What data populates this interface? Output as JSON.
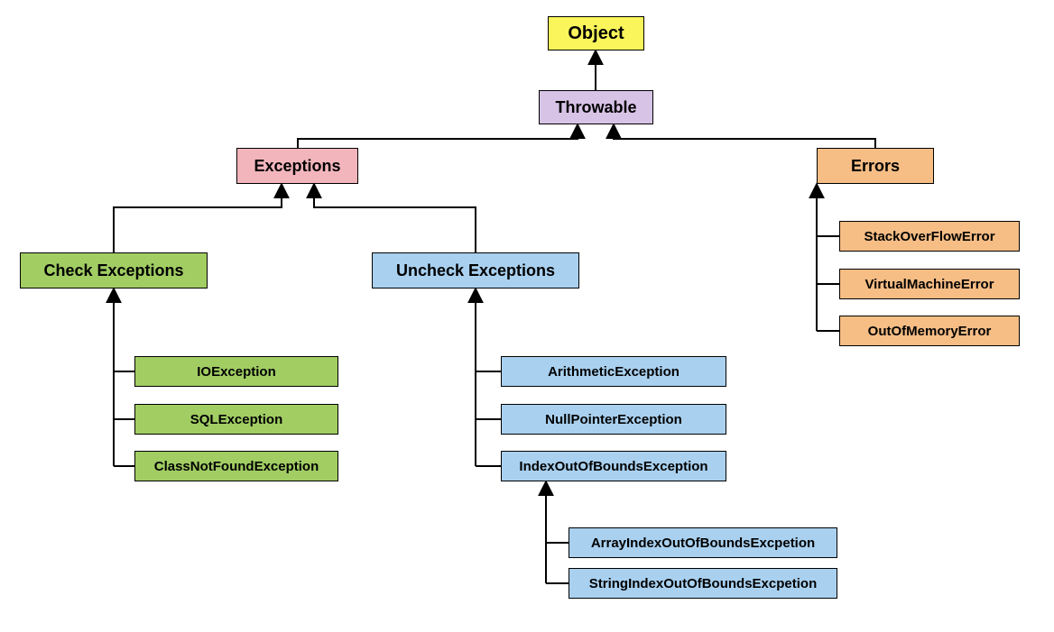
{
  "chart_data": {
    "type": "tree",
    "root": "Object",
    "edges": [
      [
        "Throwable",
        "Object"
      ],
      [
        "Exceptions",
        "Throwable"
      ],
      [
        "Errors",
        "Throwable"
      ],
      [
        "Check Exceptions",
        "Exceptions"
      ],
      [
        "Uncheck Exceptions",
        "Exceptions"
      ],
      [
        "IOException",
        "Check Exceptions"
      ],
      [
        "SQLException",
        "Check Exceptions"
      ],
      [
        "ClassNotFoundException",
        "Check Exceptions"
      ],
      [
        "ArithmeticException",
        "Uncheck Exceptions"
      ],
      [
        "NullPointerException",
        "Uncheck Exceptions"
      ],
      [
        "IndexOutOfBoundsException",
        "Uncheck Exceptions"
      ],
      [
        "ArrayIndexOutOfBoundsExcpetion",
        "IndexOutOfBoundsException"
      ],
      [
        "StringIndexOutOfBoundsExcpetion",
        "IndexOutOfBoundsException"
      ],
      [
        "StackOverFlowError",
        "Errors"
      ],
      [
        "VirtualMachineError",
        "Errors"
      ],
      [
        "OutOfMemoryError",
        "Errors"
      ]
    ]
  },
  "colors": {
    "yellow": "#faf55a",
    "purple": "#d7c3e6",
    "pink": "#f3b5bc",
    "green": "#a1cd63",
    "blue": "#a9d0ef",
    "orange": "#f6bd85"
  },
  "nodes": {
    "object": {
      "label": "Object"
    },
    "throwable": {
      "label": "Throwable"
    },
    "exceptions": {
      "label": "Exceptions"
    },
    "errors": {
      "label": "Errors"
    },
    "checkEx": {
      "label": "Check Exceptions"
    },
    "uncheckEx": {
      "label": "Uncheck Exceptions"
    },
    "ioException": {
      "label": "IOException"
    },
    "sqlException": {
      "label": "SQLException"
    },
    "cnfException": {
      "label": "ClassNotFoundException"
    },
    "arithmetic": {
      "label": "ArithmeticException"
    },
    "nullPtr": {
      "label": "NullPointerException"
    },
    "indexOOB": {
      "label": "IndexOutOfBoundsException"
    },
    "arrayOOB": {
      "label": "ArrayIndexOutOfBoundsExcpetion"
    },
    "stringOOB": {
      "label": "StringIndexOutOfBoundsExcpetion"
    },
    "stackOF": {
      "label": "StackOverFlowError"
    },
    "vmError": {
      "label": "VirtualMachineError"
    },
    "oom": {
      "label": "OutOfMemoryError"
    }
  }
}
